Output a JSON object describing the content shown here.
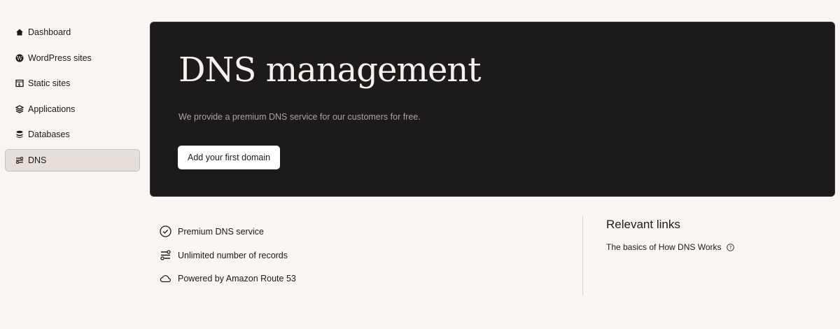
{
  "sidebar": {
    "items": [
      {
        "label": "Dashboard",
        "icon": "home-icon"
      },
      {
        "label": "WordPress sites",
        "icon": "wordpress-icon"
      },
      {
        "label": "Static sites",
        "icon": "static-site-icon"
      },
      {
        "label": "Applications",
        "icon": "layers-icon"
      },
      {
        "label": "Databases",
        "icon": "database-icon"
      },
      {
        "label": "DNS",
        "icon": "dns-icon",
        "active": true
      }
    ]
  },
  "hero": {
    "title": "DNS management",
    "subtitle": "We provide a premium DNS service for our customers for free.",
    "button": "Add your first domain"
  },
  "features": [
    "Premium DNS service",
    "Unlimited number of records",
    "Powered by Amazon Route 53"
  ],
  "relevant": {
    "heading": "Relevant links",
    "links": [
      "The basics of How DNS Works"
    ]
  }
}
